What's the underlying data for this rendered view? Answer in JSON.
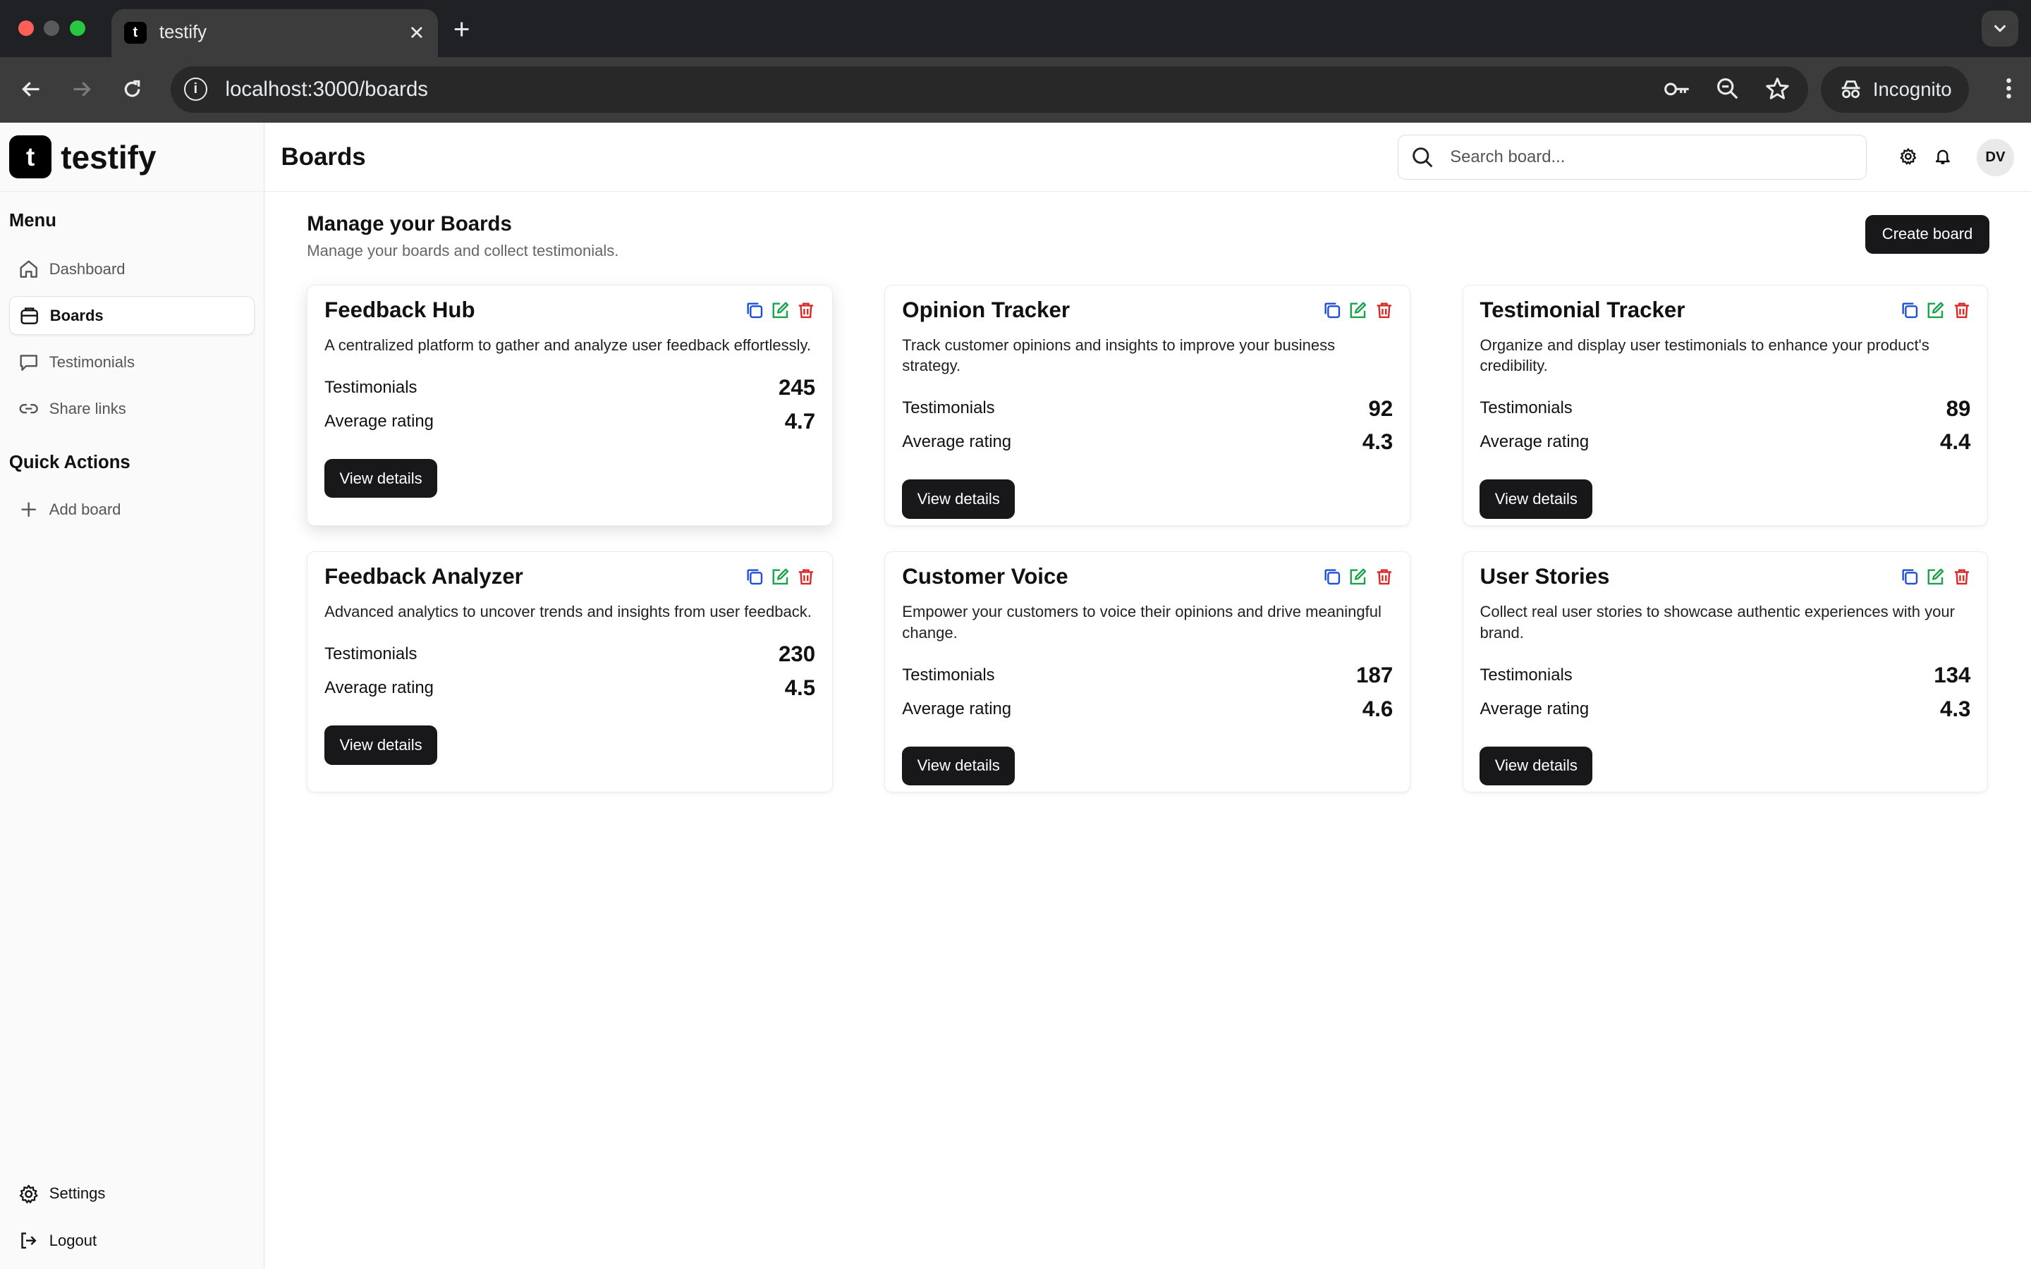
{
  "browser": {
    "tab_title": "testify",
    "tab_favicon": "t",
    "url": "localhost:3000/boards",
    "profile_label": "Incognito"
  },
  "sidebar": {
    "brand_letter": "t",
    "brand_name": "testify",
    "menu_title": "Menu",
    "items": [
      {
        "label": "Dashboard",
        "icon": "home-icon"
      },
      {
        "label": "Boards",
        "icon": "board-icon",
        "active": true
      },
      {
        "label": "Testimonials",
        "icon": "message-icon"
      },
      {
        "label": "Share links",
        "icon": "link-icon"
      }
    ],
    "quick_actions_title": "Quick Actions",
    "quick_actions": [
      {
        "label": "Add board",
        "icon": "plus-icon"
      }
    ],
    "bottom": [
      {
        "label": "Settings",
        "icon": "gear-icon"
      },
      {
        "label": "Logout",
        "icon": "logout-icon"
      }
    ]
  },
  "header": {
    "title": "Boards",
    "search_placeholder": "Search board...",
    "avatar_initials": "DV"
  },
  "content": {
    "section_title": "Manage your Boards",
    "section_subtitle": "Manage your boards and collect testimonials.",
    "create_button": "Create board",
    "testimonials_label": "Testimonials",
    "rating_label": "Average rating",
    "view_details_label": "View details",
    "boards": [
      {
        "title": "Feedback Hub",
        "description": "A centralized platform to gather and analyze user feedback effortlessly.",
        "testimonials": "245",
        "rating": "4.7"
      },
      {
        "title": "Opinion Tracker",
        "description": "Track customer opinions and insights to improve your business strategy.",
        "testimonials": "92",
        "rating": "4.3"
      },
      {
        "title": "Testimonial Tracker",
        "description": "Organize and display user testimonials to enhance your product's credibility.",
        "testimonials": "89",
        "rating": "4.4"
      },
      {
        "title": "Feedback Analyzer",
        "description": "Advanced analytics to uncover trends and insights from user feedback.",
        "testimonials": "230",
        "rating": "4.5"
      },
      {
        "title": "Customer Voice",
        "description": "Empower your customers to voice their opinions and drive meaningful change.",
        "testimonials": "187",
        "rating": "4.6"
      },
      {
        "title": "User Stories",
        "description": "Collect real user stories to showcase authentic experiences with your brand.",
        "testimonials": "134",
        "rating": "4.3"
      }
    ]
  },
  "colors": {
    "copy_icon": "#1d4ed8",
    "edit_icon": "#16a34a",
    "delete_icon": "#dc2626",
    "primary_button": "#18181b"
  }
}
